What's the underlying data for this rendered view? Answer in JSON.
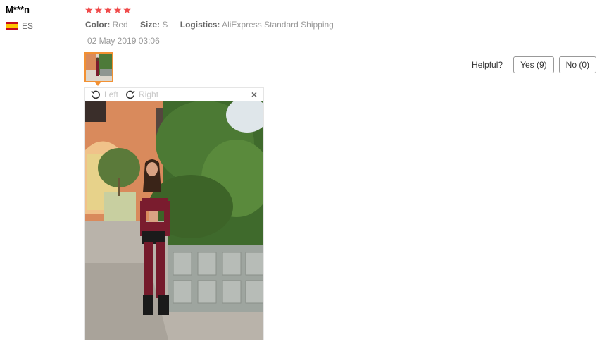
{
  "review": {
    "user_name": "M***n",
    "country_code": "ES",
    "rating": 5,
    "attributes": [
      {
        "key": "Color:",
        "value": "Red"
      },
      {
        "key": "Size:",
        "value": "S"
      },
      {
        "key": "Logistics:",
        "value": "AliExpress Standard Shipping"
      }
    ],
    "date": "02 May 2019 03:06"
  },
  "helpful": {
    "label": "Helpful?",
    "yes_label": "Yes (9)",
    "no_label": "No (0)"
  },
  "viewer": {
    "rotate_left_label": "Left",
    "rotate_right_label": "Right",
    "close_icon": "×"
  },
  "colors": {
    "star": "#f04a4a",
    "thumb_border": "#f29133",
    "muted_text": "#999999"
  }
}
